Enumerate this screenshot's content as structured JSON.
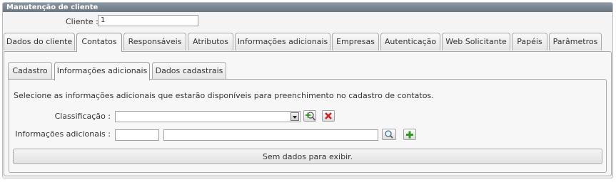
{
  "window": {
    "title": "Manutenção de cliente"
  },
  "client": {
    "label": "Cliente :",
    "value": "1"
  },
  "main_tabs": [
    {
      "label": "Dados do cliente"
    },
    {
      "label": "Contatos"
    },
    {
      "label": "Responsáveis"
    },
    {
      "label": "Atributos"
    },
    {
      "label": "Informações adicionais"
    },
    {
      "label": "Empresas"
    },
    {
      "label": "Autenticação"
    },
    {
      "label": "Web Solicitante"
    },
    {
      "label": "Papéis"
    },
    {
      "label": "Parâmetros"
    }
  ],
  "active_main_tab": "Contatos",
  "sub_tabs": [
    {
      "label": "Cadastro"
    },
    {
      "label": "Informações adicionais"
    },
    {
      "label": "Dados cadastrais"
    }
  ],
  "active_sub_tab": "Informações adicionais",
  "form": {
    "description": "Selecione as informações adicionais que estarão disponíveis para preenchimento no cadastro de contatos.",
    "classificacao_label": "Classificação :",
    "classificacao_value": "",
    "info_label": "Informações adicionais :",
    "info_code_value": "",
    "info_desc_value": ""
  },
  "grid": {
    "empty_text": "Sem dados para exibir."
  },
  "icons": {
    "add_classification": "add-search-icon",
    "remove_classification": "delete-x-icon",
    "search_info": "magnifier-icon",
    "add_info": "plus-icon"
  },
  "colors": {
    "titlebar": "#7a8692",
    "add_green": "#2e9a1e",
    "delete_red": "#d42020"
  }
}
